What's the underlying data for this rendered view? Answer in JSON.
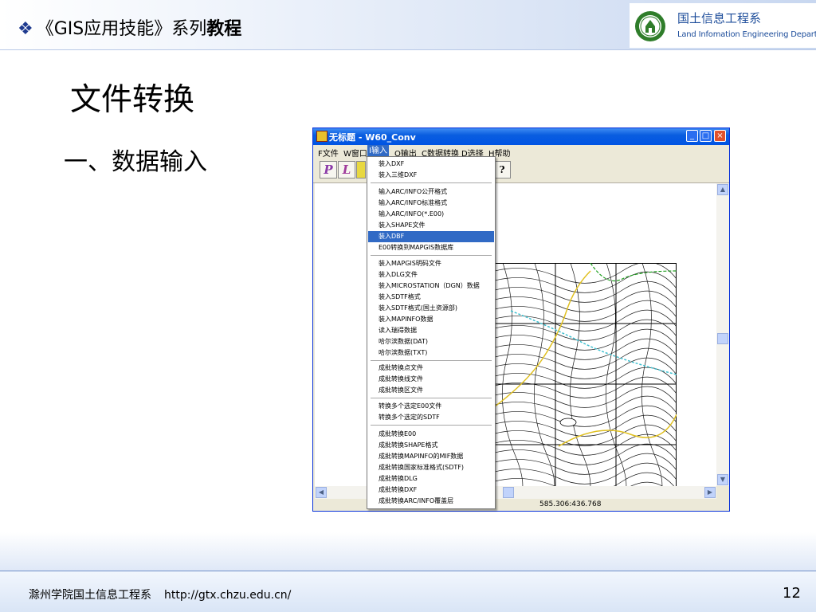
{
  "header": {
    "bullet": "❖",
    "title_prefix": "《GIS应用技能》系列",
    "title_emphasis": "教程",
    "dept_cn": "国土信息工程系",
    "dept_en": "Land Infomation Engineering Department"
  },
  "slide": {
    "title": "文件转换",
    "subtitle": "一、数据输入"
  },
  "window": {
    "title": "无标题 - W60_Conv",
    "caption_buttons": [
      "_",
      "□",
      "×"
    ],
    "menu": [
      {
        "label": "F文件"
      },
      {
        "label": "W窗口"
      },
      {
        "label": "I输入",
        "active": true
      },
      {
        "label": "O输出"
      },
      {
        "label": "C数据转换"
      },
      {
        "label": "D选择"
      },
      {
        "label": "H帮助"
      }
    ],
    "toolbar": [
      "P",
      "L",
      "?"
    ],
    "status_coords": "585.306:436.768",
    "scroll_arrows": {
      "up": "▲",
      "down": "▼",
      "left": "◀",
      "right": "▶"
    }
  },
  "dropdown": {
    "groups": [
      [
        "装入DXF",
        "装入三维DXF"
      ],
      [
        "输入ARC/INFO公开格式",
        "输入ARC/INFO标准格式",
        "输入ARC/INFO(*.E00)",
        "装入SHAPE文件",
        "装入DBF",
        "E00转换到MAPGIS数据库"
      ],
      [
        "装入MAPGIS明码文件",
        "装入DLG文件",
        "装入MICROSTATION（DGN）数据",
        "装入SDTF格式",
        "装入SDTF格式(国土资源部)",
        "装入MAPINFO数据",
        "读入瑞得数据",
        "哈尔滨数据(DAT)",
        "哈尔滨数据(TXT)"
      ],
      [
        "成批转换点文件",
        "成批转换线文件",
        "成批转换区文件"
      ],
      [
        "转换多个选定E00文件",
        "转换多个选定的SDTF"
      ],
      [
        "成批转换E00",
        "成批转换SHAPE格式",
        "成批转换MAPINFO的MIF数据",
        "成批转换国家标准格式(SDTF)",
        "成批转换DLG",
        "成批转换DXF",
        "成批转换ARC/INFO覆盖层"
      ]
    ],
    "highlighted": "装入DBF"
  },
  "footer": {
    "school": "滁州学院国土信息工程系",
    "url": "http://gtx.chzu.edu.cn/",
    "page": "12"
  },
  "colors": {
    "titlebar": "#0054e3",
    "menu_highlight": "#316ac5",
    "logo_green": "#2f7d2a",
    "logo_blue": "#1c4c9a",
    "map_contour": "#1a1a1a",
    "map_yellow": "#e0c020",
    "map_cyan": "#40c0d0"
  }
}
